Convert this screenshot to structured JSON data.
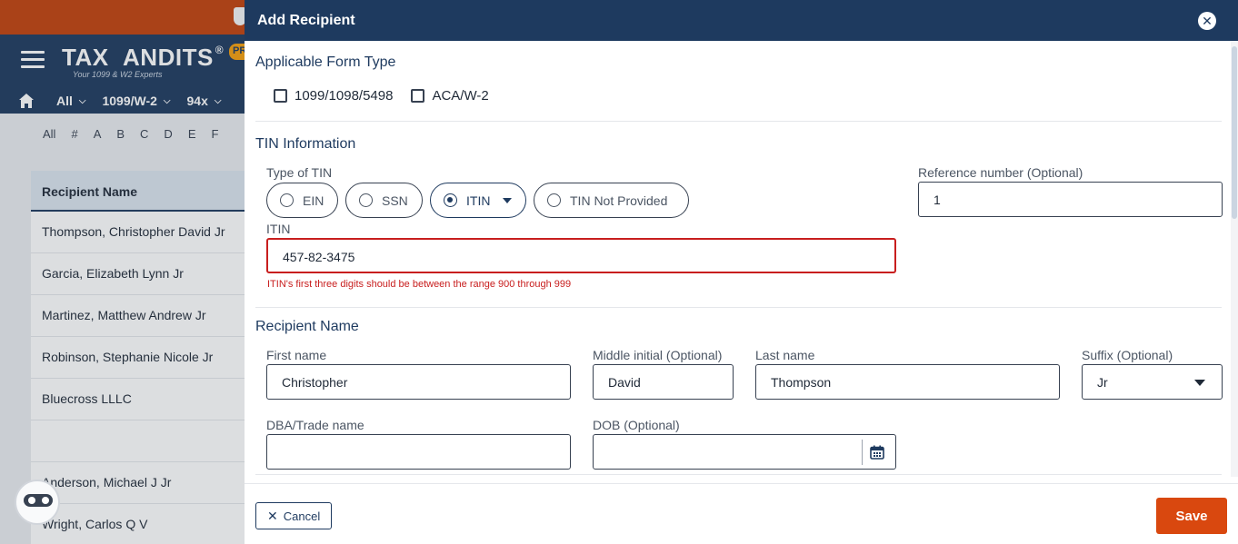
{
  "app": {
    "logo_text": "TAX  ANDITS",
    "logo_reg": "®",
    "logo_tagline": "Your 1099 & W2 Experts",
    "pro_badge": "PR",
    "nav": [
      "All",
      "1099/W-2",
      "94x"
    ],
    "alphabet": [
      "All",
      "#",
      "A",
      "B",
      "C",
      "D",
      "E",
      "F"
    ],
    "recipients_header": "Recipient Name",
    "recipients": [
      "Thompson, Christopher David Jr",
      "Garcia, Elizabeth Lynn Jr",
      "Martinez, Matthew Andrew Jr",
      "Robinson, Stephanie Nicole Jr",
      "Bluecross LLLC",
      "",
      "Anderson, Michael J Jr",
      "Wright, Carlos Q V"
    ]
  },
  "modal": {
    "title": "Add Recipient",
    "close_icon": "close-icon",
    "form_type": {
      "title": "Applicable Form Type",
      "options": [
        {
          "label": "1099/1098/5498",
          "checked": false
        },
        {
          "label": "ACA/W-2",
          "checked": false
        }
      ]
    },
    "tin": {
      "title": "TIN Information",
      "type_label": "Type of TIN",
      "options": [
        {
          "label": "EIN",
          "selected": false
        },
        {
          "label": "SSN",
          "selected": false
        },
        {
          "label": "ITIN",
          "selected": true
        },
        {
          "label": "TIN Not Provided",
          "selected": false
        }
      ],
      "reference_label": "Reference number (Optional)",
      "reference_value": "1",
      "itin_label": "ITIN",
      "itin_value": "457-82-3475",
      "error": "ITIN's first three digits should be between the range 900 through 999"
    },
    "recipient_name": {
      "title": "Recipient Name",
      "first_label": "First name",
      "first_value": "Christopher",
      "middle_label": "Middle initial (Optional)",
      "middle_value": "David",
      "last_label": "Last name",
      "last_value": "Thompson",
      "suffix_label": "Suffix (Optional)",
      "suffix_value": "Jr",
      "dba_label": "DBA/Trade name",
      "dba_value": "",
      "dob_label": "DOB (Optional)",
      "dob_value": ""
    },
    "footer": {
      "cancel_label": "Cancel",
      "save_label": "Save"
    }
  },
  "colors": {
    "header_navy": "#1e3a5f",
    "top_orange": "#c2410c",
    "save_orange": "#d9480f",
    "error_red": "#c81e1e"
  }
}
